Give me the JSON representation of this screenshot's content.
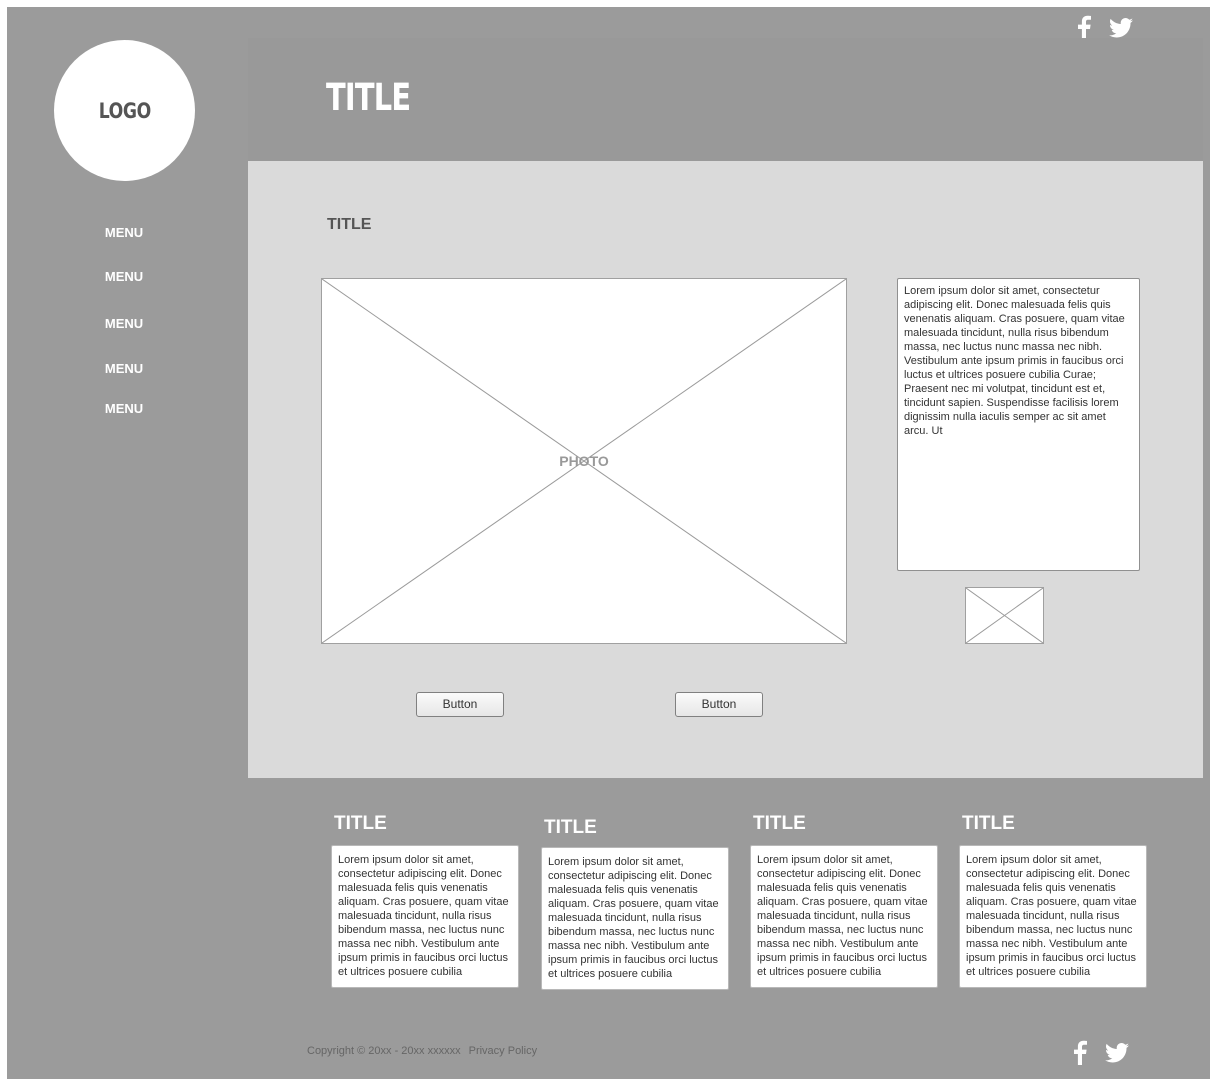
{
  "header": {
    "logo_text": "LOGO",
    "title": "TITLE",
    "social": [
      "facebook-icon",
      "twitter-icon"
    ]
  },
  "sidebar": {
    "items": [
      {
        "label": "MENU"
      },
      {
        "label": "MENU"
      },
      {
        "label": "MENU"
      },
      {
        "label": "MENU"
      },
      {
        "label": "MENU"
      }
    ]
  },
  "main": {
    "title": "TITLE",
    "photo_label": "PHOTO",
    "side_text": "Lorem ipsum dolor sit amet, consectetur adipiscing elit. Donec malesuada felis quis venenatis aliquam. Cras posuere, quam vitae malesuada tincidunt, nulla risus bibendum massa, nec luctus nunc massa nec nibh. Vestibulum ante ipsum primis in faucibus orci luctus et ultrices posuere cubilia Curae; Praesent nec mi volutpat, tincidunt est et, tincidunt sapien. Suspendisse facilisis lorem dignissim nulla iaculis semper ac sit amet arcu. Ut",
    "buttons": [
      {
        "label": "Button"
      },
      {
        "label": "Button"
      }
    ]
  },
  "cards": [
    {
      "title": "TITLE",
      "text": "Lorem ipsum dolor sit amet, consectetur adipiscing elit. Donec malesuada felis quis venenatis aliquam. Cras posuere, quam vitae malesuada tincidunt, nulla risus bibendum massa, nec luctus nunc massa nec nibh. Vestibulum ante ipsum primis in faucibus orci luctus et ultrices posuere cubilia"
    },
    {
      "title": "TITLE",
      "text": "Lorem ipsum dolor sit amet, consectetur adipiscing elit. Donec malesuada felis quis venenatis aliquam. Cras posuere, quam vitae malesuada tincidunt, nulla risus bibendum massa, nec luctus nunc massa nec nibh. Vestibulum ante ipsum primis in faucibus orci luctus et ultrices posuere cubilia"
    },
    {
      "title": "TITLE",
      "text": "Lorem ipsum dolor sit amet, consectetur adipiscing elit. Donec malesuada felis quis venenatis aliquam. Cras posuere, quam vitae malesuada tincidunt, nulla risus bibendum massa, nec luctus nunc massa nec nibh. Vestibulum ante ipsum primis in faucibus orci luctus et ultrices posuere cubilia"
    },
    {
      "title": "TITLE",
      "text": "Lorem ipsum dolor sit amet, consectetur adipiscing elit. Donec malesuada felis quis venenatis aliquam. Cras posuere, quam vitae malesuada tincidunt, nulla risus bibendum massa, nec luctus nunc massa nec nibh. Vestibulum ante ipsum primis in faucibus orci luctus et ultrices posuere cubilia"
    }
  ],
  "footer": {
    "copyright": "Copyright © 20xx - 20xx xxxxxx",
    "privacy": "Privacy Policy",
    "social": [
      "facebook-icon",
      "twitter-icon"
    ]
  },
  "colors": {
    "frame": "#9b9b9b",
    "content": "#dadada",
    "text_light": "#ffffff",
    "text_dark": "#555555"
  }
}
